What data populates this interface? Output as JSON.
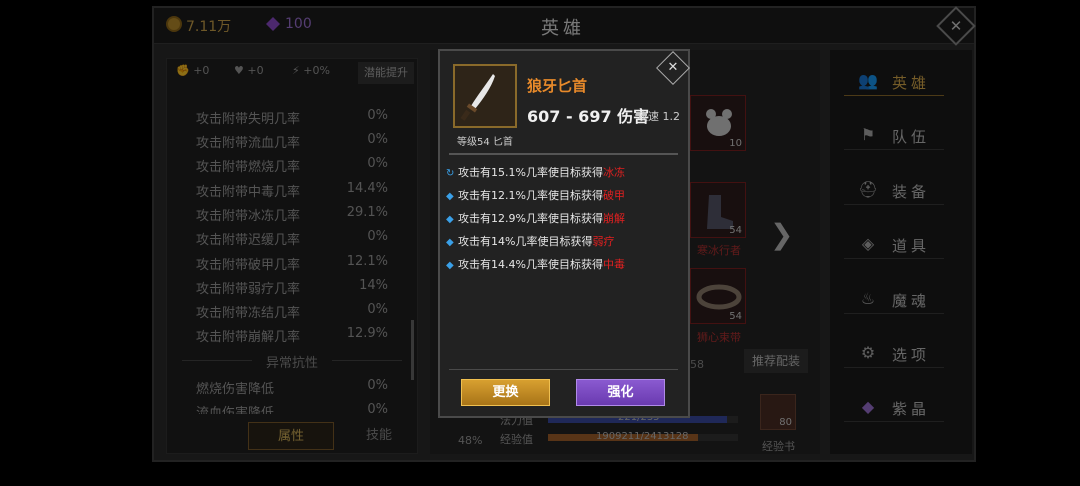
{
  "topbar": {
    "gold": "7.11万",
    "gems": "100",
    "title": "英雄"
  },
  "left_panel": {
    "boosts": [
      "+0",
      "+0",
      "+0%"
    ],
    "boost_button": "潜能提升",
    "stats": [
      {
        "label": "攻击附带失明几率",
        "value": "0%"
      },
      {
        "label": "攻击附带流血几率",
        "value": "0%"
      },
      {
        "label": "攻击附带燃烧几率",
        "value": "0%"
      },
      {
        "label": "攻击附带中毒几率",
        "value": "14.4%"
      },
      {
        "label": "攻击附带冰冻几率",
        "value": "29.1%"
      },
      {
        "label": "攻击附带迟缓几率",
        "value": "0%"
      },
      {
        "label": "攻击附带破甲几率",
        "value": "12.1%"
      },
      {
        "label": "攻击附带弱疗几率",
        "value": "14%"
      },
      {
        "label": "攻击附带冻结几率",
        "value": "0%"
      },
      {
        "label": "攻击附带崩解几率",
        "value": "12.9%"
      }
    ],
    "section_title": "异常抗性",
    "resist": [
      {
        "label": "燃烧伤害降低",
        "value": "0%"
      },
      {
        "label": "流血伤害降低",
        "value": "0%"
      }
    ],
    "tabs": [
      "属性",
      "技能"
    ]
  },
  "hero_area": {
    "slots": [
      {
        "num": "10",
        "name": ""
      },
      {
        "num": "54",
        "name": "寒冰行者"
      },
      {
        "num": "54",
        "name": "狮心束带"
      }
    ],
    "side_value": "58",
    "recommend_button": "推荐配装",
    "percent": "48%",
    "mana_label": "法力值",
    "mana_value": "221/235",
    "exp_label": "经验值",
    "exp_value": "1909211/2413128",
    "exp_fraction": 0.79,
    "book_count": "80",
    "book_label": "经验书"
  },
  "right_menu": [
    {
      "label": "英雄",
      "icon": "hero-icon",
      "active": true
    },
    {
      "label": "队伍",
      "icon": "flag-icon",
      "active": false
    },
    {
      "label": "装备",
      "icon": "helmet-icon",
      "active": false
    },
    {
      "label": "道具",
      "icon": "bag-icon",
      "active": false
    },
    {
      "label": "魔魂",
      "icon": "flame-icon",
      "active": false
    },
    {
      "label": "选项",
      "icon": "gear-icon",
      "active": false
    },
    {
      "label": "紫晶",
      "icon": "crystal-icon",
      "active": false
    }
  ],
  "popup": {
    "item_name": "狼牙匕首",
    "damage": "607 - 697 伤害",
    "speed": "攻速 1.2",
    "level": "等级54 匕首",
    "effects": [
      {
        "prefix": "攻击有15.1%几率使目标获得",
        "keyword": "冰冻",
        "bullet": "C"
      },
      {
        "prefix": "攻击有12.1%几率使目标获得",
        "keyword": "破甲",
        "bullet": "◆"
      },
      {
        "prefix": "攻击有12.9%几率使目标获得",
        "keyword": "崩解",
        "bullet": "◆"
      },
      {
        "prefix": "攻击有14%几率使目标获得",
        "keyword": "弱疗",
        "bullet": "◆"
      },
      {
        "prefix": "攻击有14.4%几率使目标获得",
        "keyword": "中毒",
        "bullet": "◆"
      }
    ],
    "replace_button": "更换",
    "upgrade_button": "强化"
  },
  "colors": {
    "gold": "#c9a04a",
    "purple": "#9a6fcf",
    "accent": "#d6a84a",
    "red_keyword": "#e02020"
  }
}
